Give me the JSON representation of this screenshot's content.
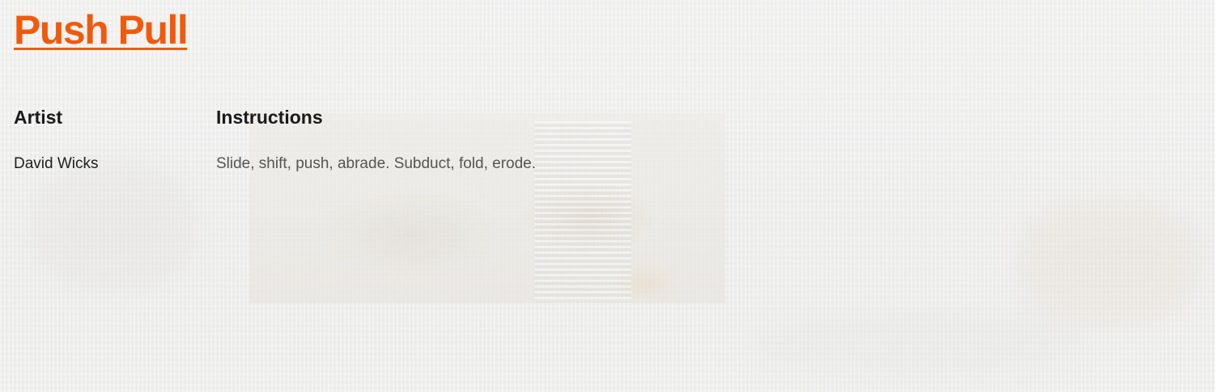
{
  "header": {
    "title": "Push Pull"
  },
  "artist": {
    "heading": "Artist",
    "name": "David Wicks"
  },
  "instructions": {
    "heading": "Instructions",
    "text": "Slide, shift, push, abrade. Subduct, fold, erode."
  },
  "colors": {
    "title_accent": "#f05a0d",
    "heading": "#1a1a1a",
    "body_text": "#555555",
    "background": "#f0f0ef"
  }
}
